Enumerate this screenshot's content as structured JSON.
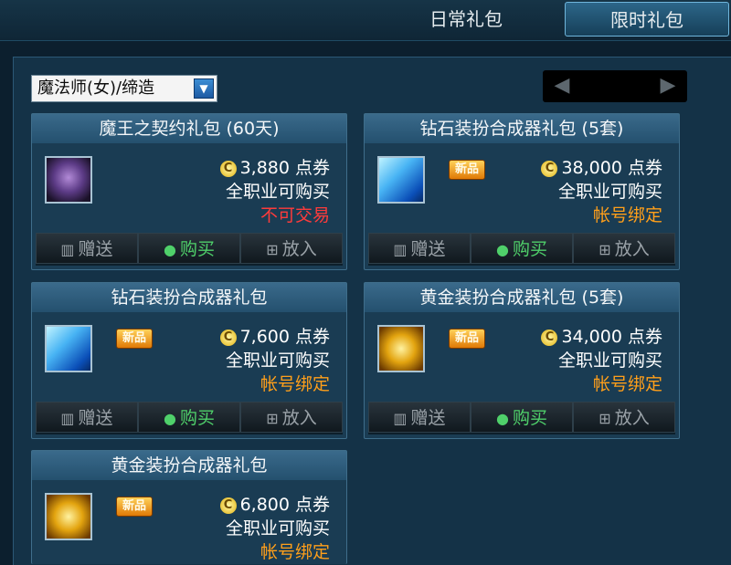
{
  "tabs": {
    "daily": "日常礼包",
    "limited": "限时礼包"
  },
  "filter": {
    "selected": "魔法师(女)/缔造"
  },
  "colors": {
    "untradable": "#ff3b3b",
    "account_bound": "#ff9f1a",
    "buy_button": "#4fd06a"
  },
  "buttons": {
    "gift": "赠送",
    "buy": "购买",
    "cart": "放入"
  },
  "cards": [
    {
      "title": "魔王之契约礼包 (60天)",
      "icon": "demon-head-icon",
      "is_new": false,
      "new_label": "",
      "price": "3,880 点券",
      "availability": "全职业可购买",
      "restriction": "不可交易",
      "restriction_color": "#ff3b3b"
    },
    {
      "title": "钻石装扮合成器礼包 (5套)",
      "icon": "diamond-cube-icon",
      "is_new": true,
      "new_label": "新品",
      "price": "38,000 点券",
      "availability": "全职业可购买",
      "restriction": "帐号绑定",
      "restriction_color": "#ff9f1a"
    },
    {
      "title": "钻石装扮合成器礼包",
      "icon": "diamond-cube-icon",
      "is_new": true,
      "new_label": "新品",
      "price": "7,600 点券",
      "availability": "全职业可购买",
      "restriction": "帐号绑定",
      "restriction_color": "#ff9f1a"
    },
    {
      "title": "黄金装扮合成器礼包 (5套)",
      "icon": "gold-cube-icon",
      "is_new": true,
      "new_label": "新品",
      "price": "34,000 点券",
      "availability": "全职业可购买",
      "restriction": "帐号绑定",
      "restriction_color": "#ff9f1a"
    },
    {
      "title": "黄金装扮合成器礼包",
      "icon": "gold-cube-icon",
      "is_new": true,
      "new_label": "新品",
      "price": "6,800 点券",
      "availability": "全职业可购买",
      "restriction": "帐号绑定",
      "restriction_color": "#ff9f1a"
    }
  ]
}
